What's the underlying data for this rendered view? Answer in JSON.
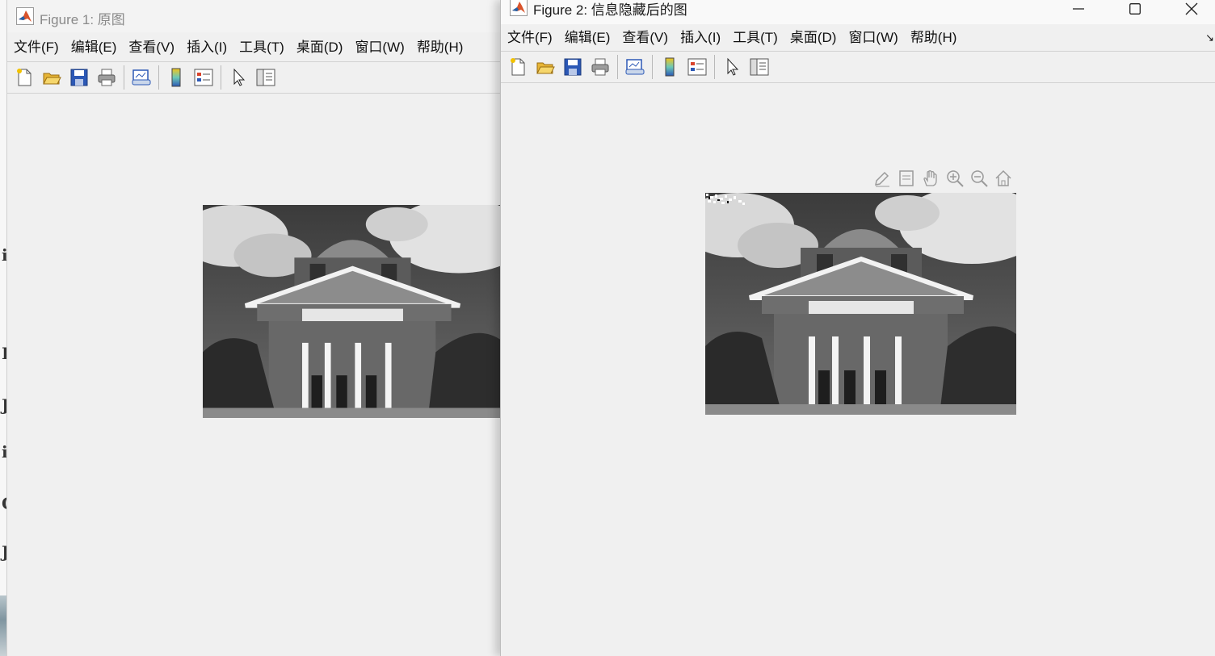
{
  "background_window": {
    "glyphs": [
      "i",
      "I",
      "J",
      "i",
      "C",
      "J"
    ]
  },
  "figure1": {
    "title": "Figure 1: 原图",
    "menus": [
      "文件(F)",
      "编辑(E)",
      "查看(V)",
      "插入(I)",
      "工具(T)",
      "桌面(D)",
      "窗口(W)",
      "帮助(H)"
    ],
    "toolbar": [
      "new-figure-icon",
      "open-file-icon",
      "save-icon",
      "print-icon",
      "link-plot-icon",
      "colorbar-icon",
      "legend-icon",
      "select-arrow-icon",
      "property-inspector-icon"
    ]
  },
  "figure2": {
    "title": "Figure 2: 信息隐藏后的图",
    "menus": [
      "文件(F)",
      "编辑(E)",
      "查看(V)",
      "插入(I)",
      "工具(T)",
      "桌面(D)",
      "窗口(W)",
      "帮助(H)"
    ],
    "toolbar": [
      "new-figure-icon",
      "open-file-icon",
      "save-icon",
      "print-icon",
      "link-plot-icon",
      "colorbar-icon",
      "legend-icon",
      "select-arrow-icon",
      "property-inspector-icon"
    ],
    "axes_toolbar": [
      "brush-icon",
      "datatip-icon",
      "pan-hand-icon",
      "zoom-in-icon",
      "zoom-out-icon",
      "restore-view-home-icon"
    ],
    "overflow_glyph": "↘"
  },
  "colors": {
    "window_bg": "#f0f0f0",
    "matlab_orange": "#d9532b",
    "matlab_blue": "#2462a8"
  }
}
